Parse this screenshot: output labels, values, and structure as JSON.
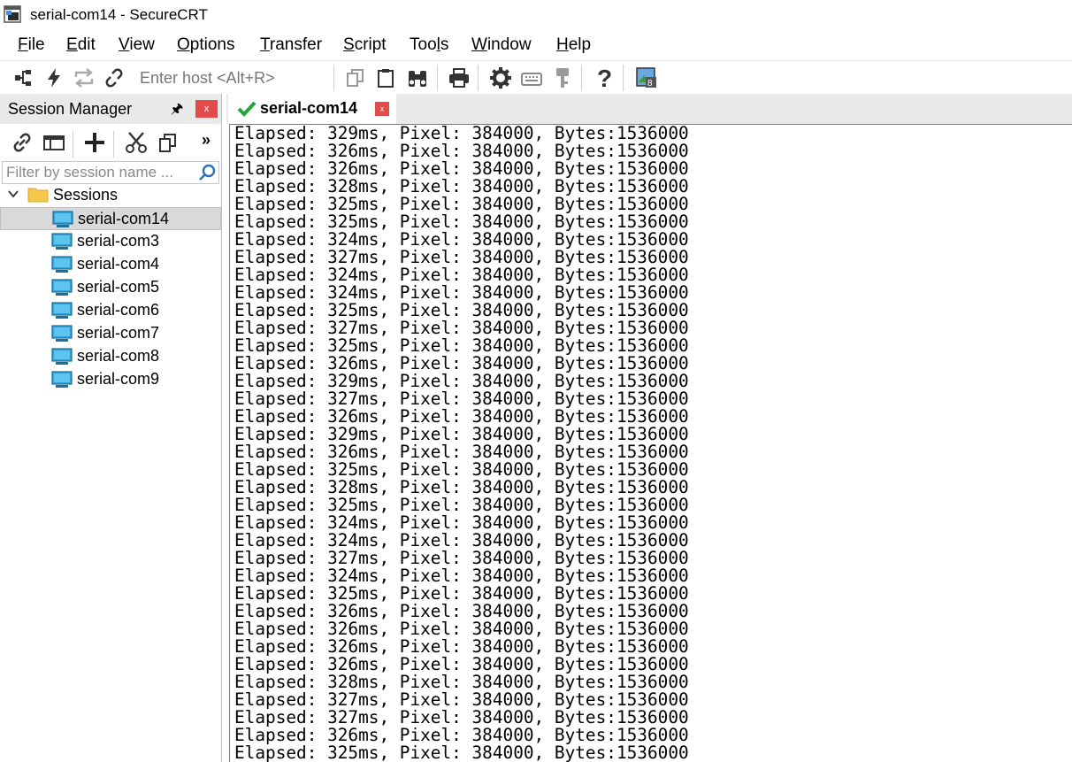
{
  "window": {
    "title": "serial-com14 - SecureCRT",
    "app_icon": "securecrt-app-icon"
  },
  "menu": [
    {
      "label": "File",
      "underline": "F",
      "rest": "ile"
    },
    {
      "label": "Edit",
      "underline": "E",
      "rest": "dit"
    },
    {
      "label": "View",
      "underline": "V",
      "rest": "iew"
    },
    {
      "label": "Options",
      "underline": "O",
      "rest": "ptions"
    },
    {
      "label": "Transfer",
      "underline": "T",
      "rest": "ransfer"
    },
    {
      "label": "Script",
      "underline": "S",
      "rest": "cript"
    },
    {
      "label": "Tools",
      "pre": "Too",
      "underline": "l",
      "rest": "s"
    },
    {
      "label": "Window",
      "underline": "W",
      "rest": "indow"
    },
    {
      "label": "Help",
      "underline": "H",
      "rest": "elp"
    }
  ],
  "toolbar": {
    "host_placeholder": "Enter host <Alt+R>",
    "icons": [
      "connect-tree-icon",
      "quick-connect-lightning-icon",
      "reconnect-icon",
      "disconnect-link-icon",
      "copy-icon",
      "paste-icon",
      "find-binoculars-icon",
      "print-icon",
      "settings-gear-icon",
      "keymap-keyboard-icon",
      "key-icon",
      "help-question-icon",
      "sftp-image-icon"
    ]
  },
  "session_manager": {
    "title": "Session Manager",
    "pin_glyph": "🖈",
    "close_glyph": "x",
    "more_glyph": "»",
    "filter_placeholder": "Filter by session name ...",
    "root_label": "Sessions",
    "sessions": [
      {
        "label": "serial-com14",
        "selected": true
      },
      {
        "label": "serial-com3",
        "selected": false
      },
      {
        "label": "serial-com4",
        "selected": false
      },
      {
        "label": "serial-com5",
        "selected": false
      },
      {
        "label": "serial-com6",
        "selected": false
      },
      {
        "label": "serial-com7",
        "selected": false
      },
      {
        "label": "serial-com8",
        "selected": false
      },
      {
        "label": "serial-com9",
        "selected": false
      }
    ]
  },
  "tab": {
    "label": "serial-com14",
    "close_glyph": "x",
    "status_color": "#22a63a"
  },
  "terminal": {
    "lines": [
      "Elapsed: 329ms, Pixel: 384000, Bytes:1536000",
      "Elapsed: 326ms, Pixel: 384000, Bytes:1536000",
      "Elapsed: 326ms, Pixel: 384000, Bytes:1536000",
      "Elapsed: 328ms, Pixel: 384000, Bytes:1536000",
      "Elapsed: 325ms, Pixel: 384000, Bytes:1536000",
      "Elapsed: 325ms, Pixel: 384000, Bytes:1536000",
      "Elapsed: 324ms, Pixel: 384000, Bytes:1536000",
      "Elapsed: 327ms, Pixel: 384000, Bytes:1536000",
      "Elapsed: 324ms, Pixel: 384000, Bytes:1536000",
      "Elapsed: 324ms, Pixel: 384000, Bytes:1536000",
      "Elapsed: 325ms, Pixel: 384000, Bytes:1536000",
      "Elapsed: 327ms, Pixel: 384000, Bytes:1536000",
      "Elapsed: 325ms, Pixel: 384000, Bytes:1536000",
      "Elapsed: 326ms, Pixel: 384000, Bytes:1536000",
      "Elapsed: 329ms, Pixel: 384000, Bytes:1536000",
      "Elapsed: 327ms, Pixel: 384000, Bytes:1536000",
      "Elapsed: 326ms, Pixel: 384000, Bytes:1536000",
      "Elapsed: 329ms, Pixel: 384000, Bytes:1536000",
      "Elapsed: 326ms, Pixel: 384000, Bytes:1536000",
      "Elapsed: 325ms, Pixel: 384000, Bytes:1536000",
      "Elapsed: 328ms, Pixel: 384000, Bytes:1536000",
      "Elapsed: 325ms, Pixel: 384000, Bytes:1536000",
      "Elapsed: 324ms, Pixel: 384000, Bytes:1536000",
      "Elapsed: 324ms, Pixel: 384000, Bytes:1536000",
      "Elapsed: 327ms, Pixel: 384000, Bytes:1536000",
      "Elapsed: 324ms, Pixel: 384000, Bytes:1536000",
      "Elapsed: 325ms, Pixel: 384000, Bytes:1536000",
      "Elapsed: 326ms, Pixel: 384000, Bytes:1536000",
      "Elapsed: 326ms, Pixel: 384000, Bytes:1536000",
      "Elapsed: 326ms, Pixel: 384000, Bytes:1536000",
      "Elapsed: 326ms, Pixel: 384000, Bytes:1536000",
      "Elapsed: 328ms, Pixel: 384000, Bytes:1536000",
      "Elapsed: 327ms, Pixel: 384000, Bytes:1536000",
      "Elapsed: 327ms, Pixel: 384000, Bytes:1536000",
      "Elapsed: 326ms, Pixel: 384000, Bytes:1536000",
      "Elapsed: 325ms, Pixel: 384000, Bytes:1536000"
    ]
  }
}
